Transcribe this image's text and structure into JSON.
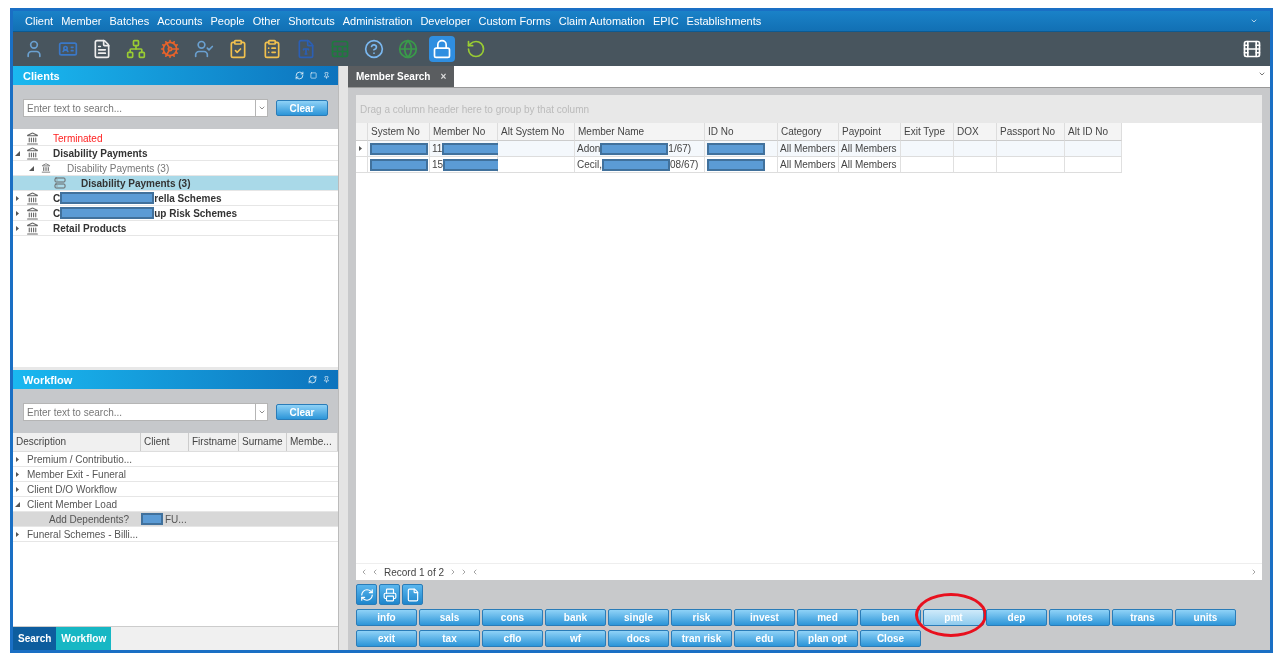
{
  "menu": [
    "Client",
    "Member",
    "Batches",
    "Accounts",
    "People",
    "Other",
    "Shortcuts",
    "Administration",
    "Developer",
    "Custom Forms",
    "Claim Automation",
    "EPIC",
    "Establishments"
  ],
  "clients": {
    "title": "Clients",
    "search": {
      "placeholder": "Enter text to search..."
    },
    "clear": "Clear",
    "tree": [
      {
        "kind": "terminated",
        "label": "Terminated",
        "selected": false
      },
      {
        "kind": "scheme",
        "label": "Disability Payments",
        "expanded": true,
        "selected": false,
        "children": [
          {
            "kind": "group",
            "label": "Disability Payments (3)",
            "expanded": true,
            "selected": false,
            "children": [
              {
                "kind": "item",
                "label": "Disability Payments (3)",
                "selected": true
              }
            ]
          }
        ]
      },
      {
        "kind": "scheme",
        "label": "C",
        "redacted": true,
        "after": "rella Schemes",
        "expanded": false,
        "selected": false
      },
      {
        "kind": "scheme",
        "label": "C",
        "redacted": true,
        "after": "up Risk Schemes",
        "expanded": false,
        "selected": false
      },
      {
        "kind": "scheme",
        "label": "Retail Products",
        "expanded": false,
        "selected": false
      }
    ]
  },
  "workflow": {
    "title": "Workflow",
    "search": {
      "placeholder": "Enter text to search..."
    },
    "clear": "Clear",
    "columns": [
      "Description",
      "Client",
      "Firstname",
      "Surname",
      "Membe..."
    ],
    "rows": [
      {
        "description": "Premium / Contributio...",
        "expanded": false,
        "selected": false
      },
      {
        "description": "Member Exit - Funeral",
        "expanded": false,
        "selected": false
      },
      {
        "description": "Client D/O Workflow",
        "expanded": false,
        "selected": false
      },
      {
        "description": "Client Member Load",
        "expanded": true,
        "selected": false,
        "children": [
          {
            "description": "Add Dependents?",
            "client_redacted": true,
            "client": "FU...",
            "selected": true
          }
        ]
      },
      {
        "description": "Funeral Schemes - Billi...",
        "expanded": false,
        "selected": false
      }
    ]
  },
  "bottom_tabs": [
    {
      "label": "Search",
      "selected": true
    },
    {
      "label": "Workflow",
      "selected": false
    }
  ],
  "document_tab": {
    "label": "Member Search",
    "close": "×"
  },
  "grid": {
    "group_hint": "Drag a column header here to group by that column",
    "columns": [
      "System No",
      "Member No",
      "Alt System No",
      "Member Name",
      "ID No",
      "Category",
      "Paypoint",
      "Exit Type",
      "DOX",
      "Passport No",
      "Alt ID No"
    ],
    "rows": [
      {
        "selected": true,
        "cells": [
          {
            "redacted": true
          },
          {
            "text": "11",
            "redacted": true
          },
          {},
          {
            "text": "Adon",
            "redacted": true,
            "after": "1/67)"
          },
          {
            "redacted": true
          },
          {
            "text": "All Members"
          },
          {
            "text": "All Members"
          },
          {},
          {},
          {},
          {}
        ]
      },
      {
        "selected": false,
        "cells": [
          {
            "redacted": true
          },
          {
            "text": "15",
            "redacted": true
          },
          {},
          {
            "text": "Cecil,",
            "redacted": true,
            "after": "08/67)"
          },
          {
            "redacted": true
          },
          {
            "text": "All Members"
          },
          {
            "text": "All Members"
          },
          {},
          {},
          {},
          {}
        ]
      }
    ],
    "pager": "Record 1 of 2"
  },
  "actions": [
    [
      {
        "label": "info",
        "highlighted": false
      },
      {
        "label": "sals",
        "highlighted": false
      },
      {
        "label": "cons",
        "highlighted": false
      },
      {
        "label": "bank",
        "highlighted": false
      },
      {
        "label": "single",
        "highlighted": false
      },
      {
        "label": "risk",
        "highlighted": false
      },
      {
        "label": "invest",
        "highlighted": false
      },
      {
        "label": "med",
        "highlighted": false
      },
      {
        "label": "ben",
        "highlighted": false
      },
      {
        "label": "pmt",
        "highlighted": true
      },
      {
        "label": "dep",
        "highlighted": false
      },
      {
        "label": "notes",
        "highlighted": false
      },
      {
        "label": "trans",
        "highlighted": false
      },
      {
        "label": "units",
        "highlighted": false
      }
    ],
    [
      {
        "label": "exit",
        "highlighted": false
      },
      {
        "label": "tax",
        "highlighted": false
      },
      {
        "label": "cflo",
        "highlighted": false
      },
      {
        "label": "wf",
        "highlighted": false
      },
      {
        "label": "docs",
        "highlighted": false
      },
      {
        "label": "tran risk",
        "highlighted": false
      },
      {
        "label": "edu",
        "highlighted": false
      },
      {
        "label": "plan opt",
        "highlighted": false
      },
      {
        "label": "Close",
        "highlighted": false
      }
    ]
  ]
}
